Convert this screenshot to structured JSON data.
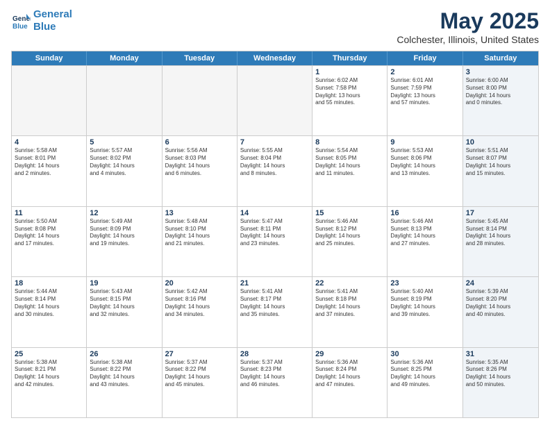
{
  "header": {
    "logo_line1": "General",
    "logo_line2": "Blue",
    "main_title": "May 2025",
    "sub_title": "Colchester, Illinois, United States"
  },
  "calendar": {
    "days_of_week": [
      "Sunday",
      "Monday",
      "Tuesday",
      "Wednesday",
      "Thursday",
      "Friday",
      "Saturday"
    ],
    "rows": [
      [
        {
          "day": "",
          "info": "",
          "empty": true
        },
        {
          "day": "",
          "info": "",
          "empty": true
        },
        {
          "day": "",
          "info": "",
          "empty": true
        },
        {
          "day": "",
          "info": "",
          "empty": true
        },
        {
          "day": "1",
          "info": "Sunrise: 6:02 AM\nSunset: 7:58 PM\nDaylight: 13 hours\nand 55 minutes.",
          "empty": false
        },
        {
          "day": "2",
          "info": "Sunrise: 6:01 AM\nSunset: 7:59 PM\nDaylight: 13 hours\nand 57 minutes.",
          "empty": false
        },
        {
          "day": "3",
          "info": "Sunrise: 6:00 AM\nSunset: 8:00 PM\nDaylight: 14 hours\nand 0 minutes.",
          "empty": false,
          "shaded": true
        }
      ],
      [
        {
          "day": "4",
          "info": "Sunrise: 5:58 AM\nSunset: 8:01 PM\nDaylight: 14 hours\nand 2 minutes.",
          "empty": false
        },
        {
          "day": "5",
          "info": "Sunrise: 5:57 AM\nSunset: 8:02 PM\nDaylight: 14 hours\nand 4 minutes.",
          "empty": false
        },
        {
          "day": "6",
          "info": "Sunrise: 5:56 AM\nSunset: 8:03 PM\nDaylight: 14 hours\nand 6 minutes.",
          "empty": false
        },
        {
          "day": "7",
          "info": "Sunrise: 5:55 AM\nSunset: 8:04 PM\nDaylight: 14 hours\nand 8 minutes.",
          "empty": false
        },
        {
          "day": "8",
          "info": "Sunrise: 5:54 AM\nSunset: 8:05 PM\nDaylight: 14 hours\nand 11 minutes.",
          "empty": false
        },
        {
          "day": "9",
          "info": "Sunrise: 5:53 AM\nSunset: 8:06 PM\nDaylight: 14 hours\nand 13 minutes.",
          "empty": false
        },
        {
          "day": "10",
          "info": "Sunrise: 5:51 AM\nSunset: 8:07 PM\nDaylight: 14 hours\nand 15 minutes.",
          "empty": false,
          "shaded": true
        }
      ],
      [
        {
          "day": "11",
          "info": "Sunrise: 5:50 AM\nSunset: 8:08 PM\nDaylight: 14 hours\nand 17 minutes.",
          "empty": false
        },
        {
          "day": "12",
          "info": "Sunrise: 5:49 AM\nSunset: 8:09 PM\nDaylight: 14 hours\nand 19 minutes.",
          "empty": false
        },
        {
          "day": "13",
          "info": "Sunrise: 5:48 AM\nSunset: 8:10 PM\nDaylight: 14 hours\nand 21 minutes.",
          "empty": false
        },
        {
          "day": "14",
          "info": "Sunrise: 5:47 AM\nSunset: 8:11 PM\nDaylight: 14 hours\nand 23 minutes.",
          "empty": false
        },
        {
          "day": "15",
          "info": "Sunrise: 5:46 AM\nSunset: 8:12 PM\nDaylight: 14 hours\nand 25 minutes.",
          "empty": false
        },
        {
          "day": "16",
          "info": "Sunrise: 5:46 AM\nSunset: 8:13 PM\nDaylight: 14 hours\nand 27 minutes.",
          "empty": false
        },
        {
          "day": "17",
          "info": "Sunrise: 5:45 AM\nSunset: 8:14 PM\nDaylight: 14 hours\nand 28 minutes.",
          "empty": false,
          "shaded": true
        }
      ],
      [
        {
          "day": "18",
          "info": "Sunrise: 5:44 AM\nSunset: 8:14 PM\nDaylight: 14 hours\nand 30 minutes.",
          "empty": false
        },
        {
          "day": "19",
          "info": "Sunrise: 5:43 AM\nSunset: 8:15 PM\nDaylight: 14 hours\nand 32 minutes.",
          "empty": false
        },
        {
          "day": "20",
          "info": "Sunrise: 5:42 AM\nSunset: 8:16 PM\nDaylight: 14 hours\nand 34 minutes.",
          "empty": false
        },
        {
          "day": "21",
          "info": "Sunrise: 5:41 AM\nSunset: 8:17 PM\nDaylight: 14 hours\nand 35 minutes.",
          "empty": false
        },
        {
          "day": "22",
          "info": "Sunrise: 5:41 AM\nSunset: 8:18 PM\nDaylight: 14 hours\nand 37 minutes.",
          "empty": false
        },
        {
          "day": "23",
          "info": "Sunrise: 5:40 AM\nSunset: 8:19 PM\nDaylight: 14 hours\nand 39 minutes.",
          "empty": false
        },
        {
          "day": "24",
          "info": "Sunrise: 5:39 AM\nSunset: 8:20 PM\nDaylight: 14 hours\nand 40 minutes.",
          "empty": false,
          "shaded": true
        }
      ],
      [
        {
          "day": "25",
          "info": "Sunrise: 5:38 AM\nSunset: 8:21 PM\nDaylight: 14 hours\nand 42 minutes.",
          "empty": false
        },
        {
          "day": "26",
          "info": "Sunrise: 5:38 AM\nSunset: 8:22 PM\nDaylight: 14 hours\nand 43 minutes.",
          "empty": false
        },
        {
          "day": "27",
          "info": "Sunrise: 5:37 AM\nSunset: 8:22 PM\nDaylight: 14 hours\nand 45 minutes.",
          "empty": false
        },
        {
          "day": "28",
          "info": "Sunrise: 5:37 AM\nSunset: 8:23 PM\nDaylight: 14 hours\nand 46 minutes.",
          "empty": false
        },
        {
          "day": "29",
          "info": "Sunrise: 5:36 AM\nSunset: 8:24 PM\nDaylight: 14 hours\nand 47 minutes.",
          "empty": false
        },
        {
          "day": "30",
          "info": "Sunrise: 5:36 AM\nSunset: 8:25 PM\nDaylight: 14 hours\nand 49 minutes.",
          "empty": false
        },
        {
          "day": "31",
          "info": "Sunrise: 5:35 AM\nSunset: 8:26 PM\nDaylight: 14 hours\nand 50 minutes.",
          "empty": false,
          "shaded": true
        }
      ]
    ]
  }
}
